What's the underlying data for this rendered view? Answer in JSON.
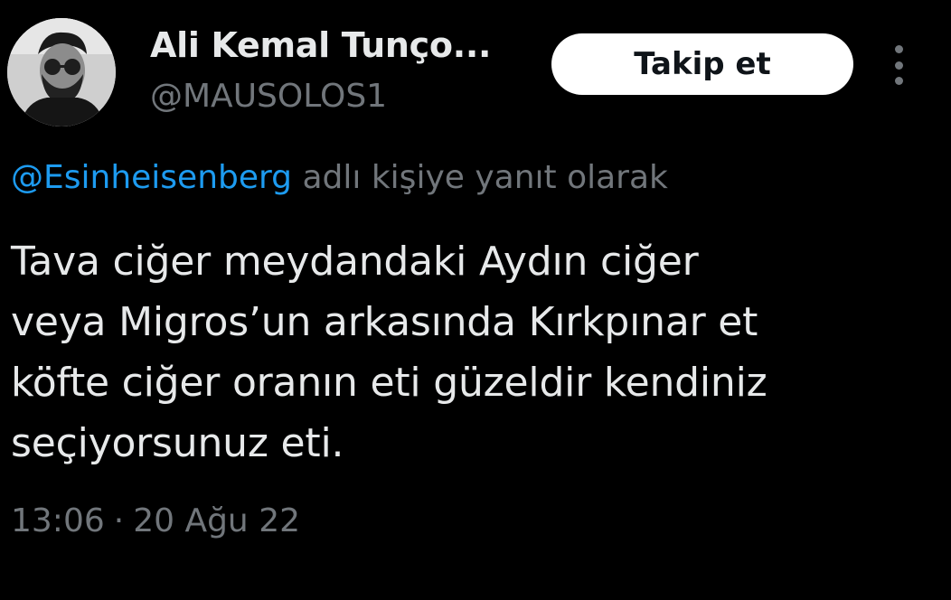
{
  "author": {
    "display_name": "Ali Kemal Tunço...",
    "handle": "@MAUSOLOS1",
    "avatar_icon": "profile-photo"
  },
  "actions": {
    "follow_label": "Takip et",
    "more_icon": "more-vertical-icon"
  },
  "reply_context": {
    "mention": "@Esinheisenberg",
    "suffix": " adlı kişiye yanıt olarak"
  },
  "tweet": {
    "text": "Tava ciğer meydandaki Aydın ciğer\nveya Migros’un arkasında Kırkpınar et\nköfte ciğer oranın eti güzeldir kendiniz\nseçiyorsunuz eti."
  },
  "meta": {
    "time": "13:06",
    "separator": "·",
    "date": "20 Ağu 22"
  },
  "colors": {
    "background": "#000000",
    "primary_text": "#e7e9ea",
    "secondary_text": "#71767b",
    "link": "#1d9bf0",
    "button_bg": "#ffffff",
    "button_text": "#0f1419"
  }
}
